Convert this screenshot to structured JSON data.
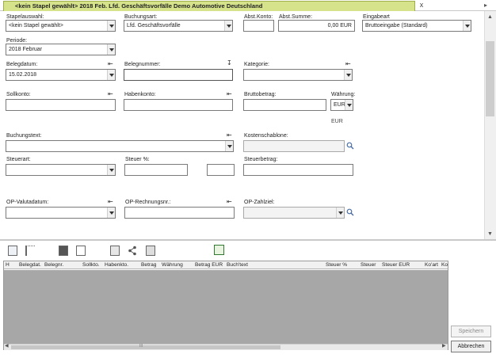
{
  "tab": {
    "title": "<kein Stapel gewählt> 2018 Feb. Lfd. Geschäftsvorfälle Demo Automotive Deutschland",
    "close_glyph": "x"
  },
  "form": {
    "stapel": {
      "label": "Stapelauswahl:",
      "value": "<kein Stapel gewählt>"
    },
    "buchungsart": {
      "label": "Buchungsart:",
      "value": "Lfd. Geschäftsvorfälle"
    },
    "abst_konto": {
      "label": "Abst.Konto:",
      "value": ""
    },
    "abst_summe": {
      "label": "Abst.Summe:",
      "value": "0,00 EUR"
    },
    "eingabeart": {
      "label": "Eingabeart",
      "value": "Bruttoeingabe (Standard)"
    },
    "periode": {
      "label": "Periode:",
      "value": "2018  Februar"
    },
    "belegdatum": {
      "label": "Belegdatum:",
      "value": "15.02.2018"
    },
    "belegnummer": {
      "label": "Belegnummer:",
      "value": ""
    },
    "kategorie": {
      "label": "Kategorie:",
      "value": ""
    },
    "sollkonto": {
      "label": "Sollkonto:",
      "value": ""
    },
    "habenkonto": {
      "label": "Habenkonto:",
      "value": ""
    },
    "bruttobetrag": {
      "label": "Bruttobetrag:",
      "value": ""
    },
    "waehrung": {
      "label": "Währung:",
      "value": "EUR",
      "hint": "EUR"
    },
    "buchungstext": {
      "label": "Buchungstext:",
      "value": ""
    },
    "kostenschablone": {
      "label": "Kostenschablone:",
      "value": ""
    },
    "steuerart": {
      "label": "Steuerart:",
      "value": ""
    },
    "steuer_pct": {
      "label": "Steuer %:",
      "value": ""
    },
    "steuerbetrag": {
      "label": "Steuerbetrag:",
      "value": ""
    },
    "op_valutadatum": {
      "label": "OP-Valutadatum:",
      "value": ""
    },
    "op_rechnungsnr": {
      "label": "OP-Rechnungsnr.:",
      "value": ""
    },
    "op_zahlziel": {
      "label": "OP-Zahlziel:",
      "value": ""
    }
  },
  "grid": {
    "columns": [
      "H",
      "Belegdat.",
      "Belegnr.",
      "Sollkto.",
      "Habenkto.",
      "Betrag",
      "Währung",
      "Betrag EUR",
      "Buch'text",
      "Steuer %",
      "Steuer",
      "Steuer EUR",
      "Ko'art",
      "Ko"
    ],
    "scroll_grip": "III"
  },
  "buttons": {
    "save": "Speichern",
    "cancel": "Abbrechen"
  },
  "colors": {
    "tab_bg": "#d6e38a",
    "grid_empty": "#a7a7a7"
  }
}
